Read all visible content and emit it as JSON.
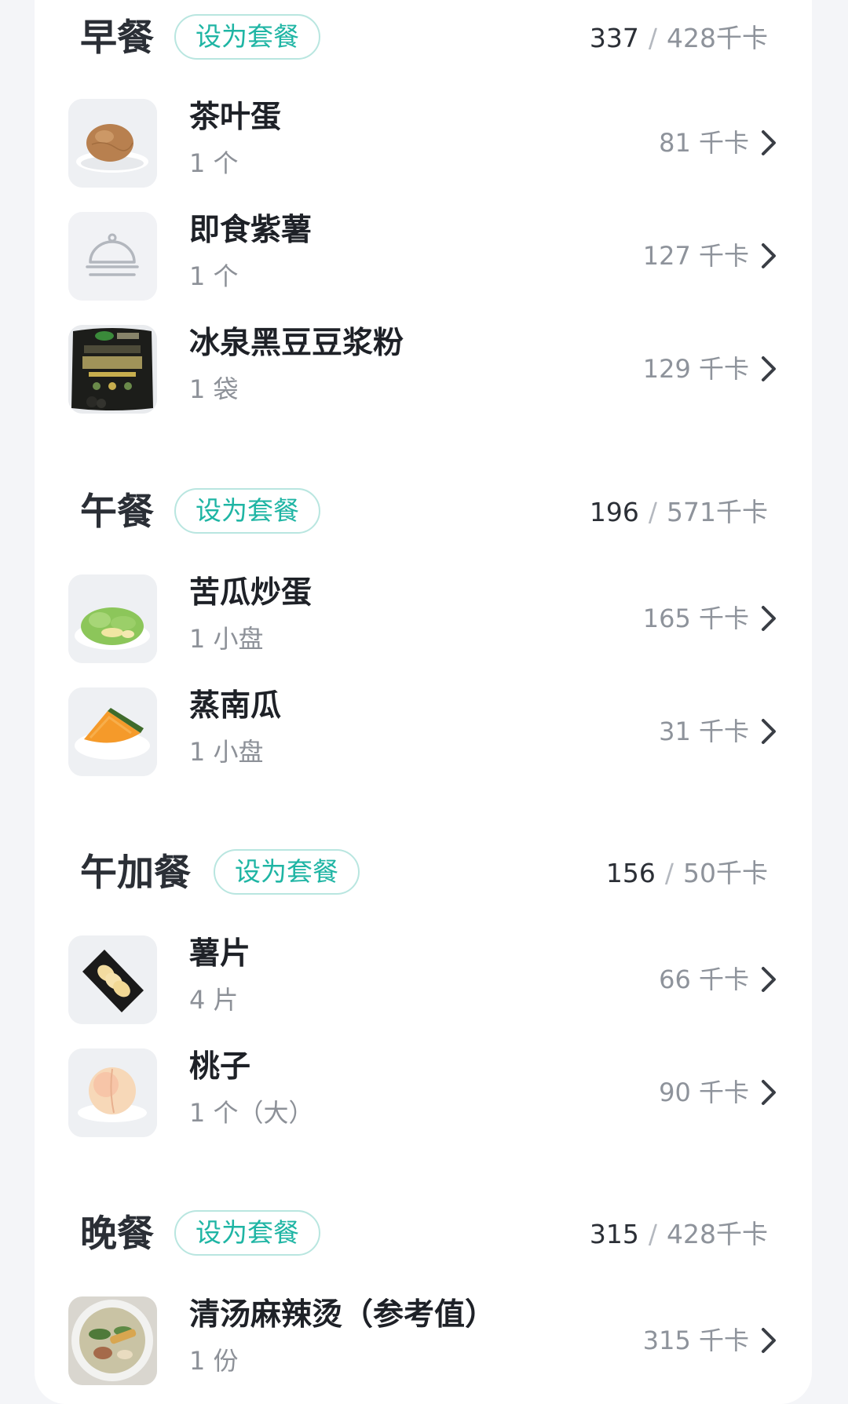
{
  "meals": [
    {
      "title": "早餐",
      "set_label": "设为套餐",
      "eaten": "337",
      "target": "428千卡",
      "items": [
        {
          "name": "茶叶蛋",
          "qty": "1 个",
          "kcal": "81 千卡",
          "icon": "tea-egg-photo"
        },
        {
          "name": "即食紫薯",
          "qty": "1 个",
          "kcal": "127 千卡",
          "icon": "food-cloche-placeholder-icon"
        },
        {
          "name": "冰泉黑豆豆浆粉",
          "qty": "1 袋",
          "kcal": "129 千卡",
          "icon": "black-bean-soy-milk-powder-package"
        }
      ]
    },
    {
      "title": "午餐",
      "set_label": "设为套餐",
      "eaten": "196",
      "target": "571千卡",
      "items": [
        {
          "name": "苦瓜炒蛋",
          "qty": "1 小盘",
          "kcal": "165 千卡",
          "icon": "bitter-melon-egg-photo"
        },
        {
          "name": "蒸南瓜",
          "qty": "1 小盘",
          "kcal": "31 千卡",
          "icon": "steamed-pumpkin-photo"
        }
      ]
    },
    {
      "title": "午加餐",
      "set_label": "设为套餐",
      "eaten": "156",
      "target": "50千卡",
      "items": [
        {
          "name": "薯片",
          "qty": "4 片",
          "kcal": "66 千卡",
          "icon": "chips-photo"
        },
        {
          "name": "桃子",
          "qty": "1 个（大）",
          "kcal": "90 千卡",
          "icon": "peach-photo"
        }
      ]
    },
    {
      "title": "晚餐",
      "set_label": "设为套餐",
      "eaten": "315",
      "target": "428千卡",
      "items": [
        {
          "name": "清汤麻辣烫（参考值）",
          "qty": "1 份",
          "kcal": "315 千卡",
          "icon": "malatang-soup-photo"
        }
      ]
    }
  ],
  "colors": {
    "accent": "#1fb5a4",
    "accent_border": "#b9e6e0",
    "page_bg": "#f4f5f8",
    "card_bg": "#ffffff",
    "title_text": "#2b2f36",
    "secondary_text": "#8e939b"
  }
}
